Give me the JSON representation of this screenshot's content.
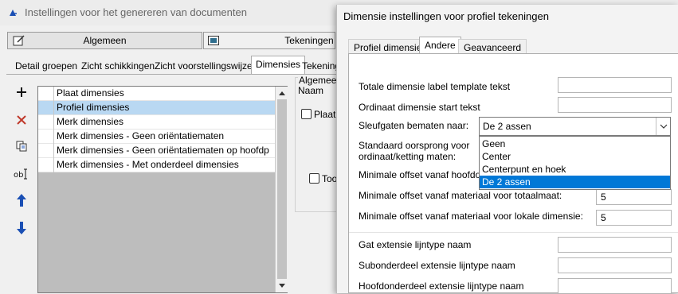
{
  "back_window": {
    "title": "Instellingen voor het genereren van documenten",
    "button_tabs": [
      "Algemeen",
      "Tekeningen"
    ],
    "tabs": [
      "Detail groepen",
      "Zicht schikkingen",
      "Zicht voorstellingswijzes",
      "Dimensies",
      "Tekening"
    ],
    "active_tab": "Dimensies",
    "list_items": [
      "Plaat dimensies",
      "Profiel dimensies",
      "Merk dimensies",
      "Merk dimensies - Geen oriëntatiematen",
      "Merk dimensies - Geen oriëntatiematen op hoofdp",
      "Merk dimensies - Met onderdeel dimensies"
    ],
    "selected_list_item": "Profiel dimensies",
    "right_group": {
      "label_algemeen": "Algemee",
      "label_naam": "Naam",
      "checkbox_plaat": "Plaat",
      "checkbox_too": "Too"
    },
    "tools": [
      "plus-icon",
      "delete-x-icon",
      "copy-icon",
      "rename-icon",
      "arrow-up-icon",
      "arrow-down-icon"
    ],
    "colors": {
      "selected_row": "#b9d8f2",
      "list_bg": "#bdbdbd",
      "arrow": "#1a4fb4",
      "delete": "#c0392b"
    }
  },
  "dialog": {
    "title": "Dimensie instellingen voor profiel tekeningen",
    "tabs": [
      "Profiel dimensies",
      "Andere",
      "Geavanceerd"
    ],
    "active_tab": "Andere",
    "fields": {
      "totale_label": "Totale dimensie label template tekst",
      "ordinaat_start": "Ordinaat dimensie start tekst",
      "sleufgaten": "Sleufgaten bematen naar:",
      "standaard_line1": "Standaard oorsprong voor",
      "standaard_line2": "ordinaat/ketting maten:",
      "min_offset_hoofd": "Minimale offset vanaf hoofdonde",
      "min_offset_totaal": "Minimale offset vanaf materiaal voor totaalmaat:",
      "min_offset_lokaal": "Minimale offset vanaf materiaal voor lokale dimensie:",
      "gat_ext": "Gat extensie lijntype naam",
      "sub_ext": "Subonderdeel extensie lijntype naam",
      "hoofd_ext": "Hoofdonderdeel extensie lijntype naam"
    },
    "values": {
      "min_offset_totaal": "5",
      "min_offset_lokaal": "5"
    },
    "combo": {
      "value": "De 2 assen",
      "options": [
        "Geen",
        "Center",
        "Centerpunt en hoek",
        "De 2 assen"
      ],
      "selected": "De 2 assen"
    },
    "colors": {
      "highlight": "#0078d7"
    }
  }
}
